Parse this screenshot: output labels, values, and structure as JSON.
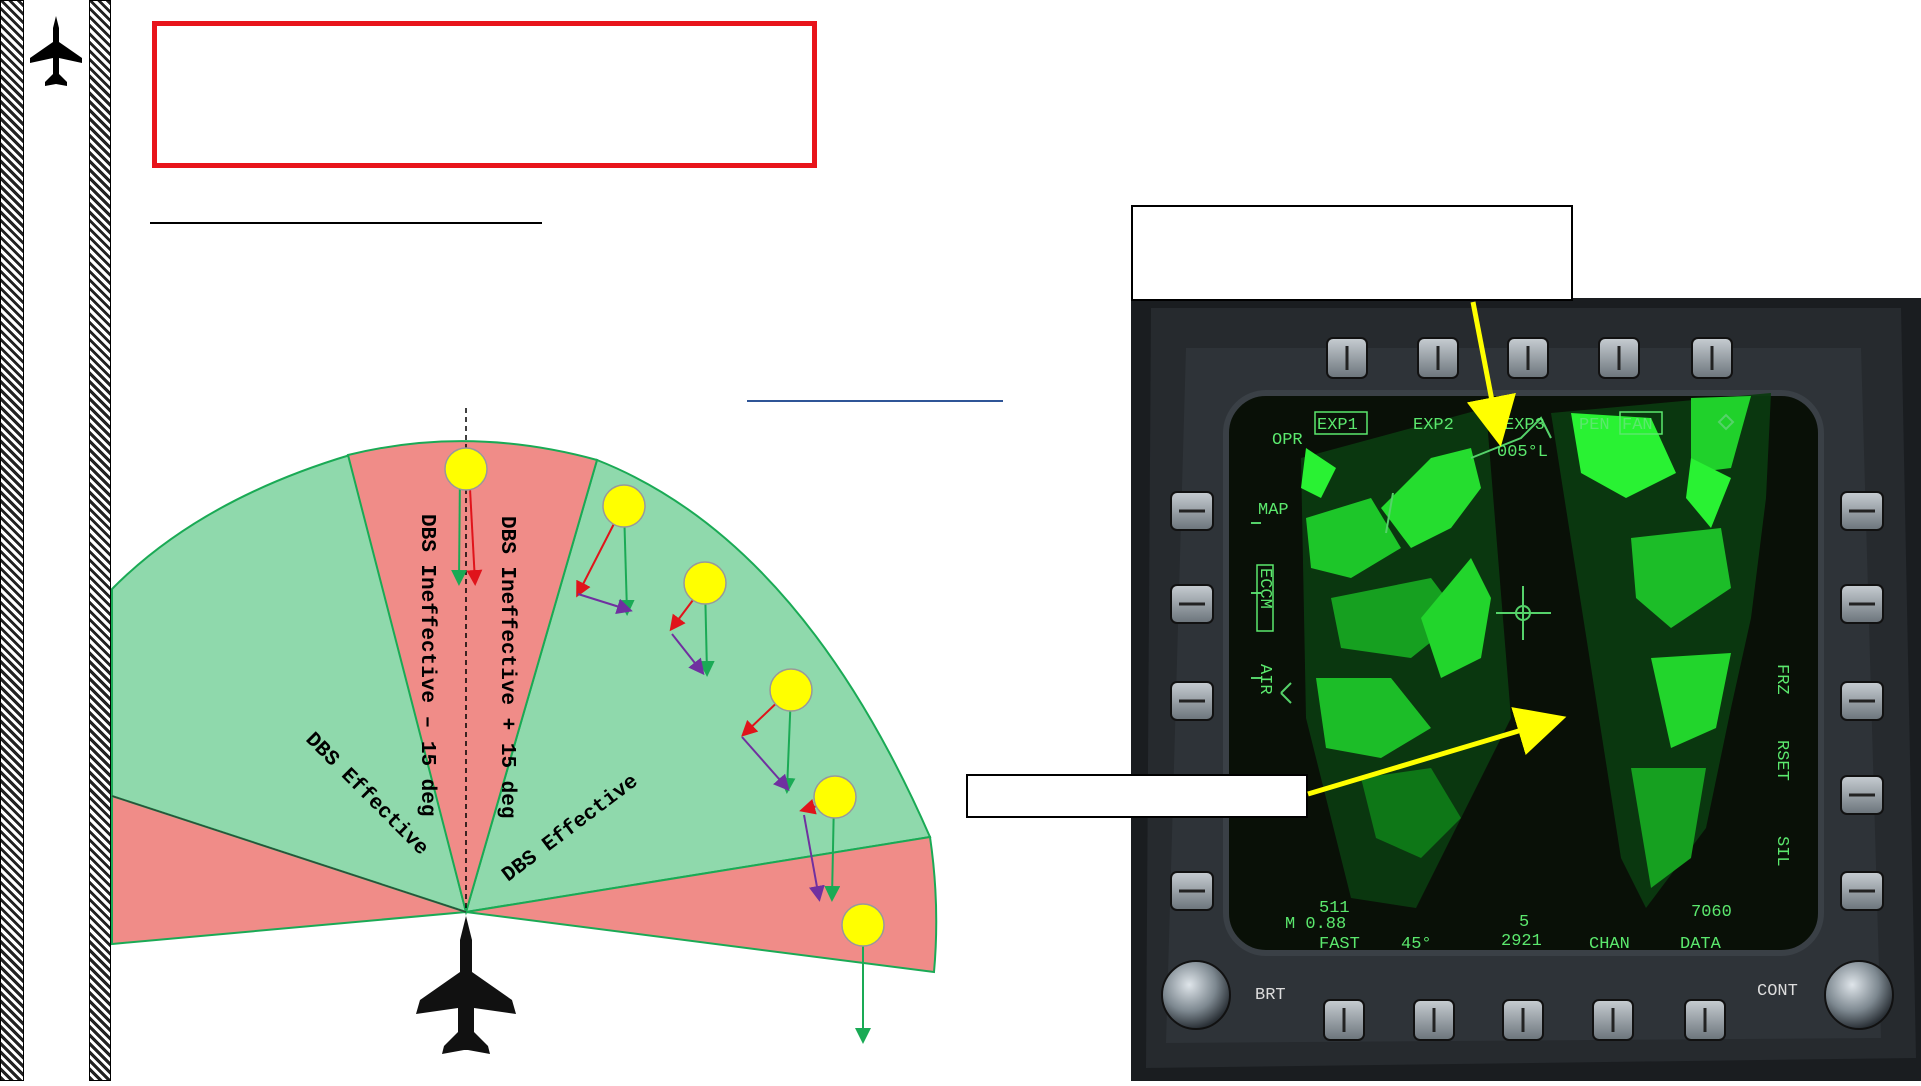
{
  "diagram": {
    "sector_labels": {
      "ineffective_minus": "DBS Ineffective – 15 deg",
      "ineffective_plus": "DBS Ineffective + 15 deg",
      "effective_left": "DBS Effective",
      "effective_right": "DBS Effective"
    },
    "colors": {
      "effective": "#8fd9ac",
      "ineffective": "#f08c88",
      "target": "#ffff00",
      "velocity": "#1aaa55",
      "radial": "#e0141b",
      "tangential": "#7030a0"
    }
  },
  "mfd": {
    "top_buttons": [
      "EXP1",
      "EXP2",
      "EXP3",
      "PEN",
      "FAN"
    ],
    "opr": "OPR",
    "azimuth": "005°L",
    "left_labels": [
      "MAP",
      "ECCM",
      "AIR"
    ],
    "right_labels": [
      "FRZ",
      "RSET",
      "SIL"
    ],
    "bottom": {
      "range": "511",
      "mach": "M 0.88",
      "fast": "FAST",
      "angle": "45°",
      "scale": "5",
      "altitude": "2921",
      "chan": "CHAN",
      "data_value": "7060",
      "data": "DATA"
    },
    "knob_left": "BRT",
    "knob_right": "CONT",
    "arrow_color": "#ffff00"
  }
}
